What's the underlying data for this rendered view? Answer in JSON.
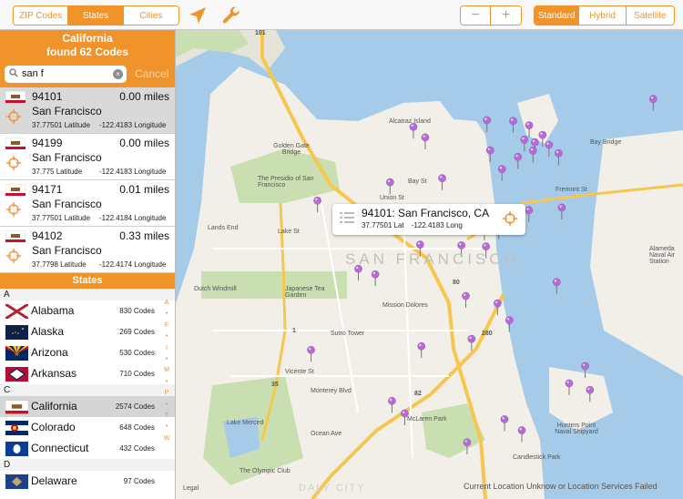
{
  "toolbar": {
    "search_modes": [
      "ZIP Codes",
      "States",
      "Cities"
    ],
    "zoom_out": "−",
    "zoom_in": "+",
    "map_types": [
      "Standard",
      "Hybrid",
      "Satellite"
    ]
  },
  "panel": {
    "state_name": "California",
    "found_text": "found 62 Codes",
    "search_value": "san f",
    "cancel_label": "Cancel"
  },
  "results": [
    {
      "zip": "94101",
      "distance": "0.00 miles",
      "city": "San Francisco",
      "lat": "37.77501 Latitude",
      "lon": "-122.4183 Longitude"
    },
    {
      "zip": "94199",
      "distance": "0.00 miles",
      "city": "San Francisco",
      "lat": "37.775 Latitude",
      "lon": "-122.4183 Longitude"
    },
    {
      "zip": "94171",
      "distance": "0.01 miles",
      "city": "San Francisco",
      "lat": "37.77501 Latitude",
      "lon": "-122.4184 Longitude"
    },
    {
      "zip": "94102",
      "distance": "0.33 miles",
      "city": "San Francisco",
      "lat": "37.7798 Latitude",
      "lon": "-122.4174 Longitude"
    }
  ],
  "states_header": "States",
  "sections": [
    {
      "letter": "A",
      "states": [
        {
          "name": "Alabama",
          "count": "830 Codes"
        },
        {
          "name": "Alaska",
          "count": "269 Codes"
        },
        {
          "name": "Arizona",
          "count": "530 Codes"
        },
        {
          "name": "Arkansas",
          "count": "710 Codes"
        }
      ]
    },
    {
      "letter": "C",
      "states": [
        {
          "name": "California",
          "count": "2574 Codes"
        },
        {
          "name": "Colorado",
          "count": "648 Codes"
        },
        {
          "name": "Connecticut",
          "count": "432 Codes"
        }
      ]
    },
    {
      "letter": "D",
      "states": [
        {
          "name": "Delaware",
          "count": "97 Codes"
        }
      ]
    }
  ],
  "index_letters": [
    "A",
    "•",
    "F",
    "•",
    "I",
    "•",
    "M",
    "•",
    "P",
    "•",
    "T",
    "•",
    "W"
  ],
  "callout": {
    "title": "94101: San Francisco, CA",
    "lat": "37.77501 Lat",
    "lon": "-122.4183 Long"
  },
  "map_labels": {
    "city_main": "SAN FRANCISCO",
    "daly_city": "DALY CITY",
    "alcatraz": "Alcatraz Island",
    "bay_bridge": "Bay Bridge",
    "golden_gate": "Golden Gate Bridge",
    "presidio": "The Presidio of San Francisco",
    "lands_end": "Lands End",
    "lake_st": "Lake St",
    "union_st": "Union St",
    "bay_st": "Bay St",
    "sutro": "Sutro Tower",
    "monterey": "Monterey Blvd",
    "mclaren": "McLaren Park",
    "lake_merced": "Lake Merced",
    "olympic": "The Olympic Club",
    "dutch": "Dutch Windmill",
    "japanese": "Japanese Tea Garden",
    "mission": "Mission Dolores",
    "hunters": "Hunters Point Naval Shipyard",
    "candlestick": "Candlestick Park",
    "alameda": "Alameda Naval Air Station",
    "fremont": "Fremont St",
    "vicente": "Vicente St",
    "ocean_ave": "Ocean Ave",
    "route_101": "101",
    "route_280": "280",
    "route_80": "80",
    "route_1": "1",
    "route_35": "35",
    "route_82": "82"
  },
  "legal": "Legal",
  "status": "Current Location Unknow or Location Services Failed",
  "colors": {
    "accent": "#f0932b",
    "water": "#a6cbe9",
    "land": "#f1efe8",
    "park": "#c9dfb2",
    "highway": "#f6c74c",
    "pin": "#b56ad6",
    "pin_selected": "#e0332f"
  },
  "pins": [
    {
      "lat": 37.8103,
      "lon": -122.3655
    },
    {
      "lat": 37.8045,
      "lon": -122.4175
    },
    {
      "lat": 37.8027,
      "lon": -122.4405
    },
    {
      "lat": 37.8043,
      "lon": -122.4093
    },
    {
      "lat": 37.8031,
      "lon": -122.4043
    },
    {
      "lat": 37.8005,
      "lon": -122.4001
    },
    {
      "lat": 37.7992,
      "lon": -122.4058
    },
    {
      "lat": 37.7985,
      "lon": -122.4025
    },
    {
      "lat": 37.7978,
      "lon": -122.3981
    },
    {
      "lat": 37.7962,
      "lon": -122.4031
    },
    {
      "lat": 37.7955,
      "lon": -122.3951
    },
    {
      "lat": 37.7945,
      "lon": -122.4078
    },
    {
      "lat": 37.7998,
      "lon": -122.4368
    },
    {
      "lat": 37.7963,
      "lon": -122.4165
    },
    {
      "lat": 37.7912,
      "lon": -122.4128
    },
    {
      "lat": 37.7887,
      "lon": -122.4315
    },
    {
      "lat": 37.7876,
      "lon": -122.4478
    },
    {
      "lat": 37.7826,
      "lon": -122.4705
    },
    {
      "lat": 37.7807,
      "lon": -122.3941
    },
    {
      "lat": 37.78,
      "lon": -122.4044
    },
    {
      "lat": 37.7752,
      "lon": -122.4138
    },
    {
      "lat": 37.7704,
      "lon": -122.4255
    },
    {
      "lat": 37.7706,
      "lon": -122.4384
    },
    {
      "lat": 37.7701,
      "lon": -122.4178
    },
    {
      "lat": 37.764,
      "lon": -122.4577
    },
    {
      "lat": 37.7625,
      "lon": -122.4524
    },
    {
      "lat": 37.7604,
      "lon": -122.3957
    },
    {
      "lat": 37.7566,
      "lon": -122.4241
    },
    {
      "lat": 37.7546,
      "lon": -122.4142
    },
    {
      "lat": 37.75,
      "lon": -122.4105
    },
    {
      "lat": 37.7449,
      "lon": -122.4223
    },
    {
      "lat": 37.7429,
      "lon": -122.438
    },
    {
      "lat": 37.7419,
      "lon": -122.4725
    },
    {
      "lat": 37.7375,
      "lon": -122.3868
    },
    {
      "lat": 37.7328,
      "lon": -122.3918
    },
    {
      "lat": 37.731,
      "lon": -122.3853
    },
    {
      "lat": 37.728,
      "lon": -122.4472
    },
    {
      "lat": 37.7246,
      "lon": -122.4432
    },
    {
      "lat": 37.723,
      "lon": -122.412
    },
    {
      "lat": 37.72,
      "lon": -122.4066
    },
    {
      "lat": 37.7167,
      "lon": -122.4237
    }
  ],
  "selected_pin": {
    "lat": 37.77501,
    "lon": -122.4183
  }
}
